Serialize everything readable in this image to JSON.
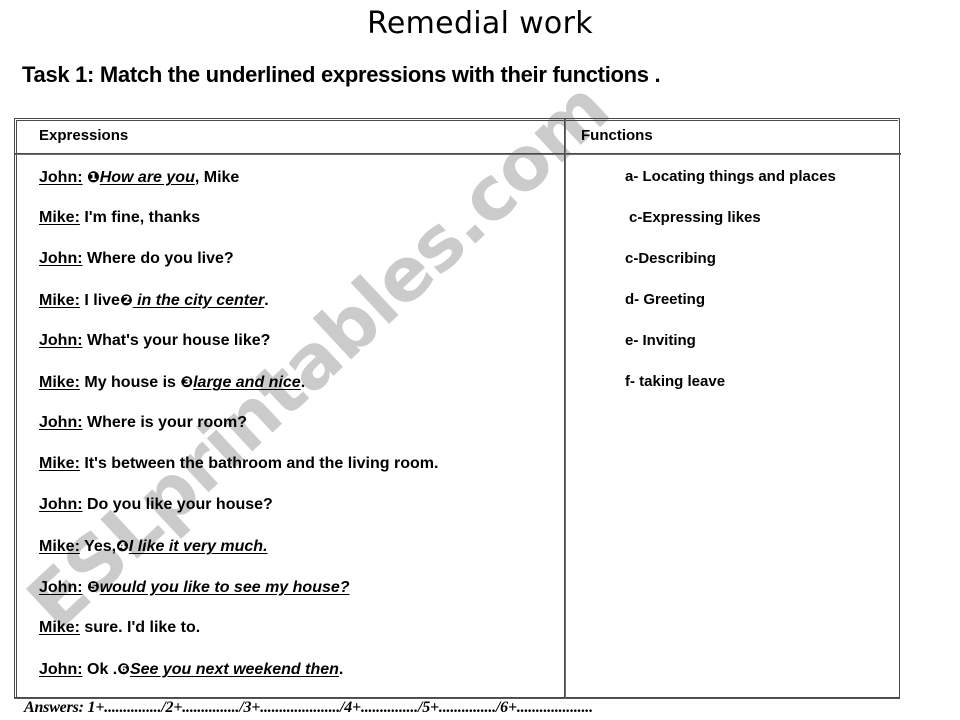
{
  "document": {
    "title": "Remedial work",
    "task_instruction": "Task 1: Match the underlined expressions with their functions .",
    "watermark": "ESLprintables.com",
    "watermark_color": "#c9c9c9",
    "background_color": "#ffffff",
    "border_color": "#4a4a4a"
  },
  "table": {
    "headers": {
      "expressions": "Expressions",
      "functions": "Functions"
    },
    "expressions": [
      {
        "speaker": "John:",
        "marker": "❶",
        "pre": "",
        "underlined": "How are you",
        "post": ", Mike"
      },
      {
        "speaker": "Mike:",
        "marker": "",
        "pre": "I'm fine, thanks",
        "underlined": "",
        "post": ""
      },
      {
        "speaker": "John:",
        "marker": "",
        "pre": "Where do you live?",
        "underlined": "",
        "post": ""
      },
      {
        "speaker": "Mike:",
        "marker": "❷",
        "pre": "I live",
        "underlined": " in the city center",
        "post": "."
      },
      {
        "speaker": "John:",
        "marker": "",
        "pre": "What's your house like?",
        "underlined": "",
        "post": ""
      },
      {
        "speaker": "Mike:",
        "marker": "❸",
        "pre": "My house is ",
        "underlined": "large and nice",
        "post": "."
      },
      {
        "speaker": "John:",
        "marker": "",
        "pre": "Where is your room?",
        "underlined": "",
        "post": ""
      },
      {
        "speaker": "Mike:",
        "marker": "",
        "pre": "It's between the bathroom and the living room.",
        "underlined": "",
        "post": ""
      },
      {
        "speaker": "John:",
        "marker": "",
        "pre": "Do you like your house?",
        "underlined": "",
        "post": ""
      },
      {
        "speaker": "Mike:",
        "marker": "❹",
        "pre": "Yes,",
        "underlined": "I  like it very much.",
        "post": ""
      },
      {
        "speaker": "John:",
        "marker": "❺",
        "pre": " ",
        "underlined": "would you like to see my house?",
        "post": ""
      },
      {
        "speaker": "Mike:",
        "marker": "",
        "pre": "sure. I'd like to.",
        "underlined": "",
        "post": ""
      },
      {
        "speaker": "John:",
        "marker": "❻",
        "pre": "Ok .",
        "underlined": "See you next weekend then",
        "post": "."
      }
    ],
    "functions": [
      "a- Locating things and places",
      "c-Expressing likes",
      "c-Describing",
      "d- Greeting",
      "e- Inviting",
      "f- taking leave"
    ]
  },
  "answers": {
    "line": "Answers: 1+.............../2+.............../3+...................../4+.............../5+.............../6+...................."
  }
}
